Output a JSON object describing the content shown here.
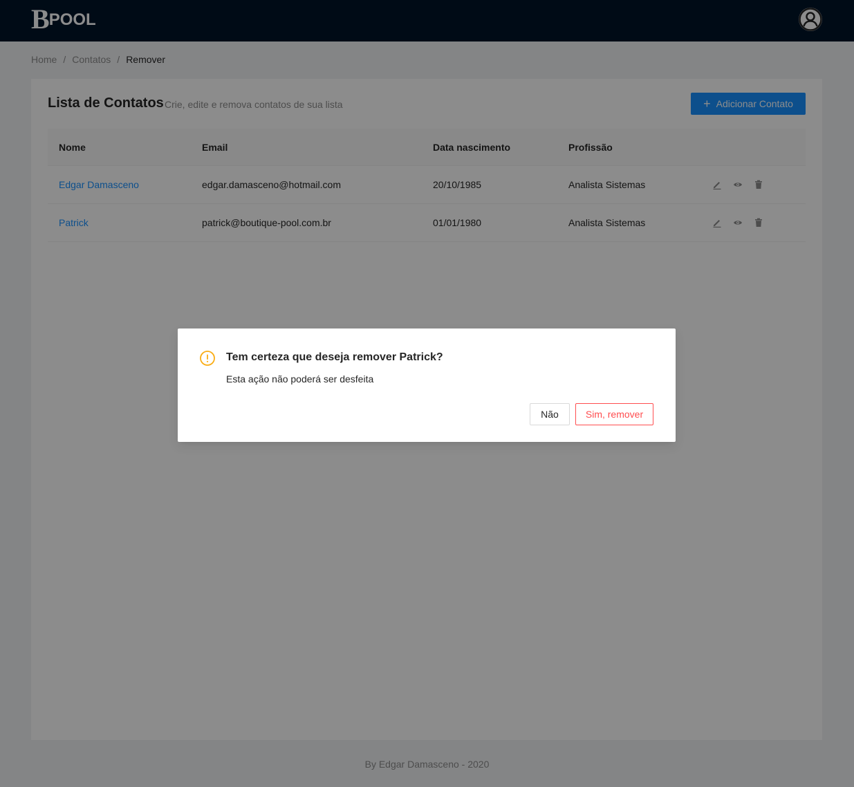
{
  "header": {
    "logo_letter": "B",
    "logo_text": "POOL",
    "avatar_icon": "user-circle-icon"
  },
  "breadcrumb": {
    "items": [
      "Home",
      "Contatos",
      "Remover"
    ],
    "separator": "/"
  },
  "card": {
    "title": "Lista de Contatos",
    "subtitle": "Crie, edite e remova contatos de sua lista",
    "add_button": {
      "icon": "+",
      "label": "Adicionar Contato"
    }
  },
  "table": {
    "columns": [
      "Nome",
      "Email",
      "Data nascimento",
      "Profissão"
    ],
    "rows": [
      {
        "nome": "Edgar Damasceno",
        "email": "edgar.damasceno@hotmail.com",
        "data": "20/10/1985",
        "profissao": "Analista Sistemas"
      },
      {
        "nome": "Patrick",
        "email": "patrick@boutique-pool.com.br",
        "data": "01/01/1980",
        "profissao": "Analista Sistemas"
      }
    ],
    "row_actions": [
      "edit-icon",
      "eye-icon",
      "delete-icon"
    ]
  },
  "footer": {
    "text": "By Edgar Damasceno - 2020"
  },
  "modal": {
    "title": "Tem certeza que deseja remover Patrick?",
    "content": "Esta ação não poderá ser desfeita",
    "cancel_label": "Não",
    "confirm_label": "Sim, remover",
    "icon": "exclamation-circle-icon"
  },
  "colors": {
    "topbar": "#001529",
    "primary": "#1890ff",
    "danger": "#ff4d4f",
    "warning": "#faad14"
  }
}
